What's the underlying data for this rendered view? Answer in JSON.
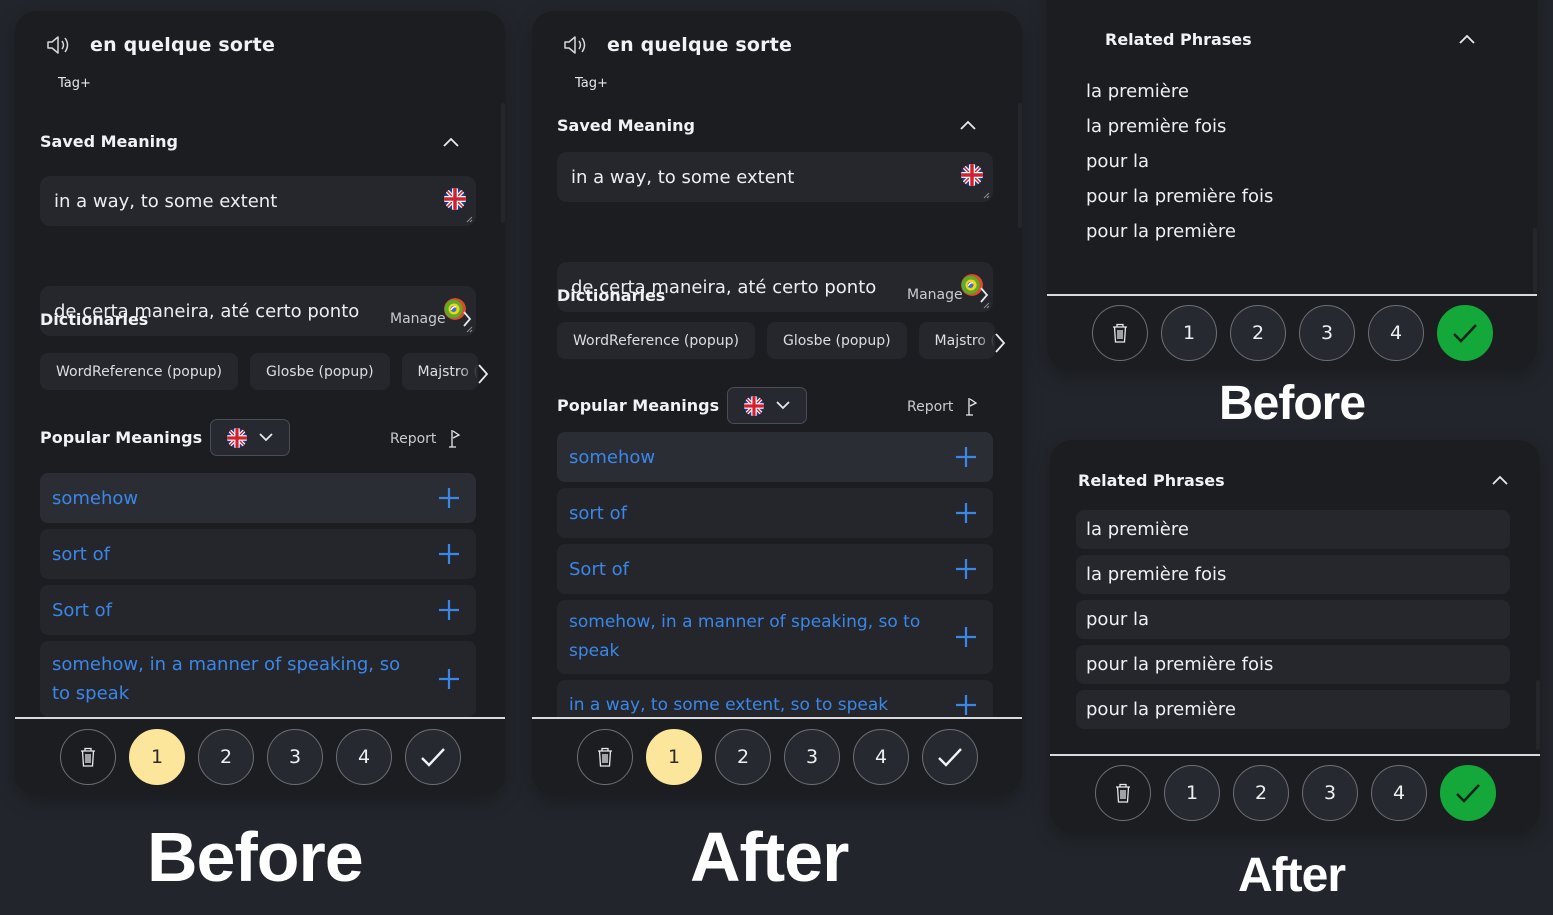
{
  "word": "en quelque sorte",
  "tag_label": "Tag",
  "saved_meaning": {
    "title": "Saved Meaning",
    "english": "in a way, to some extent",
    "portuguese": "de certa maneira, até certo ponto",
    "english_flag": "uk-flag-icon",
    "portuguese_flag": "brazil-portugal-flag-icon"
  },
  "dictionaries": {
    "title": "Dictionaries",
    "manage_label": "Manage",
    "items": [
      "WordReference (popup)",
      "Glosbe (popup)",
      "Majstro (popup)"
    ]
  },
  "popular_meanings": {
    "title": "Popular Meanings",
    "language": "English",
    "report_label": "Report",
    "before_items": [
      "somehow",
      "sort of",
      "Sort of",
      "somehow, in a manner of speaking, so to speak"
    ],
    "after_items": [
      "somehow",
      "sort of",
      "Sort of",
      "somehow, in a manner of speaking, so to speak",
      "in a way, to some extent, so to speak"
    ]
  },
  "related_phrases": {
    "title": "Related Phrases",
    "items": [
      "la première",
      "la première fois",
      "pour la",
      "pour la première fois",
      "pour la première"
    ]
  },
  "rating_buttons": [
    "1",
    "2",
    "3",
    "4"
  ],
  "colors": {
    "accent_blue": "#3b87e8",
    "selected_yellow": "#fbe69b",
    "done_green": "#14a83b",
    "panel_bg": "#1c1d20",
    "page_bg": "#22252b"
  },
  "captions": {
    "before": "Before",
    "after": "After"
  }
}
